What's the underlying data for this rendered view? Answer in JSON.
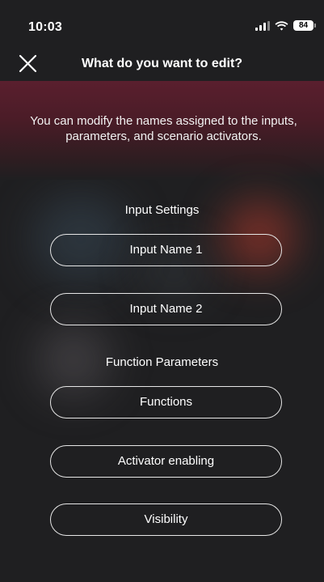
{
  "status_bar": {
    "time": "10:03",
    "signal_icon": "signal-icon",
    "wifi_icon": "wifi-icon",
    "battery_level": "84"
  },
  "header": {
    "close_icon": "close-icon",
    "title": "What do you want to edit?"
  },
  "banner": {
    "text": "You can modify the names assigned to the inputs, parameters, and scenario activators.",
    "color": "#5a1f2e"
  },
  "sections": {
    "input_settings": {
      "title": "Input Settings",
      "buttons": [
        "Input Name 1",
        "Input Name 2"
      ]
    },
    "function_parameters": {
      "title": "Function Parameters",
      "buttons": [
        "Functions",
        "Activator enabling",
        "Visibility"
      ]
    }
  },
  "colors": {
    "background": "#1f1f21",
    "accent_red": "#be3c2d",
    "button_border": "#e6e6e6"
  }
}
